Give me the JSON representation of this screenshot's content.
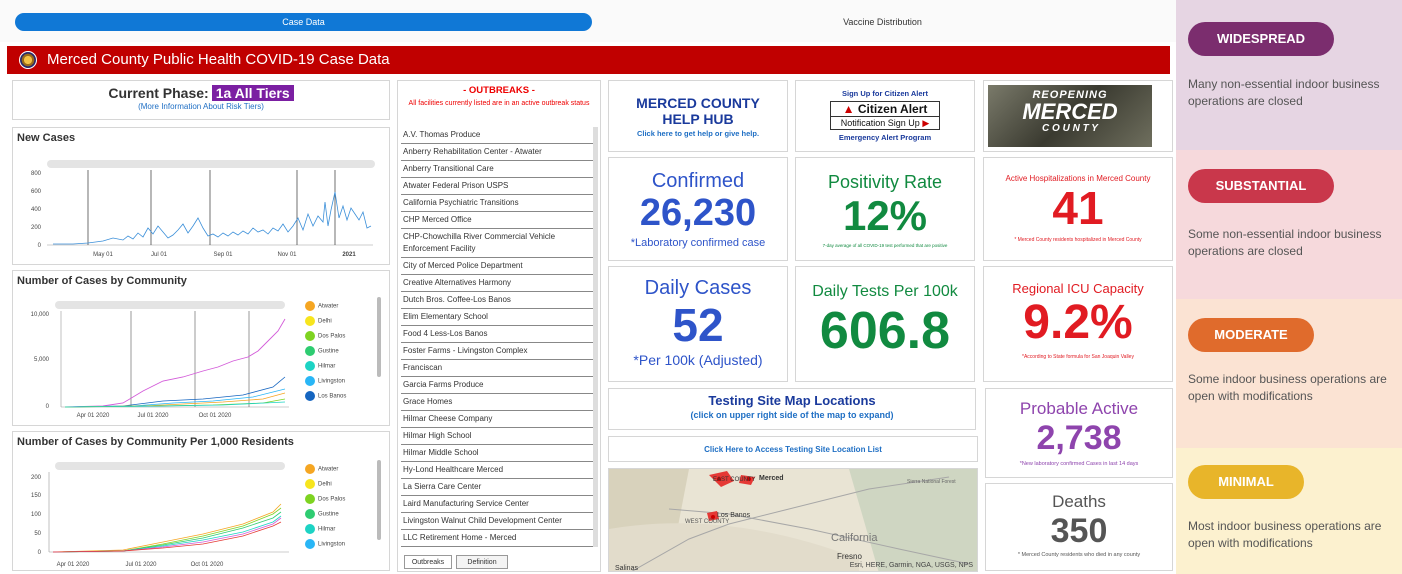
{
  "tabs": [
    {
      "label": "Case Data",
      "active": true
    },
    {
      "label": "Vaccine Distribution",
      "active": false
    }
  ],
  "title": "Merced County Public Health COVID-19 Case Data",
  "phase": {
    "label": "Current Phase:",
    "tier": "1a All Tiers",
    "link": "(More Information About Risk Tiers)"
  },
  "new_cases": {
    "title": "New Cases",
    "y_ticks": [
      "800",
      "600",
      "400",
      "200",
      "0"
    ],
    "x_ticks": [
      "May 01",
      "Jul 01",
      "Sep 01",
      "Nov 01",
      "2021"
    ]
  },
  "community": {
    "title": "Number of Cases by Community",
    "y_ticks": [
      "10,000",
      "5,000",
      "0"
    ],
    "x_ticks": [
      "Apr 01 2020",
      "Jul 01 2020",
      "Oct 01 2020"
    ],
    "legend": [
      "Atwater",
      "Delhi",
      "Dos Palos",
      "Gustine",
      "Hilmar",
      "Livingston",
      "Los Banos"
    ]
  },
  "per1000": {
    "title": "Number of Cases by Community Per 1,000 Residents",
    "y_ticks": [
      "200",
      "150",
      "100",
      "50",
      "0"
    ],
    "x_ticks": [
      "Apr 01 2020",
      "Jul 01 2020",
      "Oct 01 2020"
    ],
    "legend": [
      "Atwater",
      "Delhi",
      "Dos Palos",
      "Gustine",
      "Hilmar",
      "Livingston"
    ]
  },
  "legend_colors": [
    "#f5a623",
    "#f7e51d",
    "#7ed321",
    "#2ecc71",
    "#1dd3c4",
    "#29b6f6",
    "#1565c0"
  ],
  "outbreaks": {
    "title": "- OUTBREAKS -",
    "subtitle": "All facilities currently listed are in an active outbreak status",
    "items": [
      "A.V. Thomas Produce",
      "Anberry Rehabilitation Center - Atwater",
      "Anberry Transitional Care",
      "Atwater Federal Prison USPS",
      "California Psychiatric Transitions",
      "CHP Merced Office",
      "CHP-Chowchilla River Commercial Vehicle Enforcement Facility",
      "City of Merced Police Department",
      "Creative Alternatives Harmony",
      "Dutch Bros. Coffee-Los Banos",
      "Elim Elementary School",
      "Food 4 Less-Los Banos",
      "Foster Farms - Livingston Complex",
      "Franciscan",
      "Garcia Farms Produce",
      "Grace Homes",
      "Hilmar Cheese Company",
      "Hilmar High School",
      "Hilmar Middle School",
      "Hy-Lond Healthcare Merced",
      "La Sierra Care Center",
      "Laird Manufacturing Service Center",
      "Livingston Walnut Child Development Center",
      "LLC Retirement Home - Merced"
    ],
    "tab_outbreaks": "Outbreaks",
    "tab_definition": "Definition"
  },
  "hub": {
    "title": "MERCED COUNTY HELP HUB",
    "link": "Click here to get help or give help."
  },
  "alert": {
    "top": "Sign Up for Citizen Alert",
    "brand": "Citizen Alert",
    "btn": "Notification Sign Up",
    "bottom": "Emergency Alert Program"
  },
  "reopening": {
    "line1": "REOPENING",
    "line2": "MERCED",
    "line3": "C O U N T Y"
  },
  "confirmed": {
    "label": "Confirmed",
    "value": "26,230",
    "note": "*Laboratory confirmed case"
  },
  "positivity": {
    "label": "Positivity Rate",
    "value": "12%",
    "note": "7-day average of all COVID-19 test performed that are positive"
  },
  "hospital": {
    "label": "Active Hospitalizations in Merced County",
    "value": "41",
    "note": "* Merced County residents hospitalized in Merced County"
  },
  "daily_cases": {
    "label": "Daily Cases",
    "value": "52",
    "note": "*Per 100k (Adjusted)"
  },
  "daily_tests": {
    "label": "Daily Tests Per 100k",
    "value": "606.8"
  },
  "icu": {
    "label": "Regional ICU Capacity",
    "value": "9.2%",
    "note": "*According to State formula for San Joaquin Valley"
  },
  "testing": {
    "title": "Testing Site Map Locations",
    "sub": "(click on upper right side of the map to expand)",
    "list_link": "Click Here to Access Testing Site Location List"
  },
  "probable": {
    "label": "Probable Active",
    "value": "2,738",
    "note": "*New laboratory confirmed Cases in last 14 days"
  },
  "deaths": {
    "label": "Deaths",
    "value": "350",
    "note": "* Merced County residents who died in any county"
  },
  "map": {
    "labels": [
      "EAST COUNTY",
      "Merced",
      "Los Banos",
      "WEST COUNTY",
      "California",
      "Fresno",
      "Salinas",
      "Sierra National Forest"
    ],
    "attribution": "Esri, HERE, Garmin, NGA, USGS, NPS"
  },
  "risk": [
    {
      "label": "WIDESPREAD",
      "desc": "Many non-essential indoor business operations are closed",
      "color": "#7b2d6e",
      "bg": "#e6d5e3"
    },
    {
      "label": "SUBSTANTIAL",
      "desc": "Some non-essential indoor business operations are closed",
      "color": "#c9374b",
      "bg": "#f6d9dc"
    },
    {
      "label": "MODERATE",
      "desc": "Some indoor business operations are open with modifications",
      "color": "#e06b2c",
      "bg": "#fbe3d3"
    },
    {
      "label": "MINIMAL",
      "desc": "Most indoor business operations are open with modifications",
      "color": "#e8b52a",
      "bg": "#fcf1cf"
    }
  ]
}
